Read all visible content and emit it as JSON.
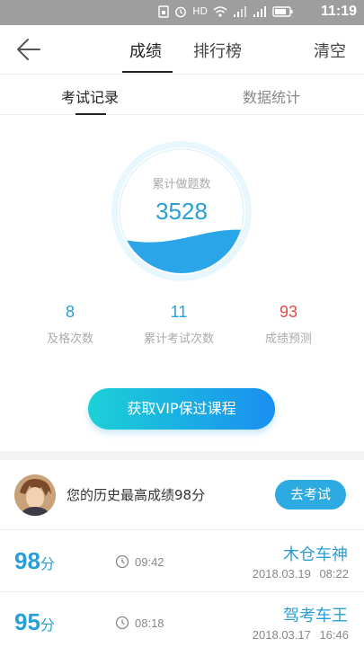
{
  "status_bar": {
    "network_label": "HD",
    "time": "11:19"
  },
  "nav": {
    "tabs": [
      "成绩",
      "排行榜"
    ],
    "active_tab": "成绩",
    "clear_label": "清空"
  },
  "subtabs": {
    "items": [
      "考试记录",
      "数据统计"
    ],
    "active": "考试记录"
  },
  "gauge": {
    "label": "累计做题数",
    "value": "3528",
    "fill_fraction": 0.3
  },
  "stats": [
    {
      "value": "8",
      "label": "及格次数"
    },
    {
      "value": "11",
      "label": "累计考试次数"
    },
    {
      "value": "93",
      "label": "成绩预测"
    }
  ],
  "vip_button_label": "获取VIP保过课程",
  "best": {
    "text": "您的历史最高成绩98分",
    "button_label": "去考试"
  },
  "records": [
    {
      "score": "98",
      "unit": "分",
      "duration": "09:42",
      "name": "木仓车神",
      "date": "2018.03.19 08:22"
    },
    {
      "score": "95",
      "unit": "分",
      "duration": "08:18",
      "name": "驾考车王",
      "date": "2018.03.17 16:46"
    }
  ],
  "colors": {
    "accent": "#2a9fd6",
    "prediction": "#e04b4b",
    "status_bar": "#9e9e9e"
  }
}
